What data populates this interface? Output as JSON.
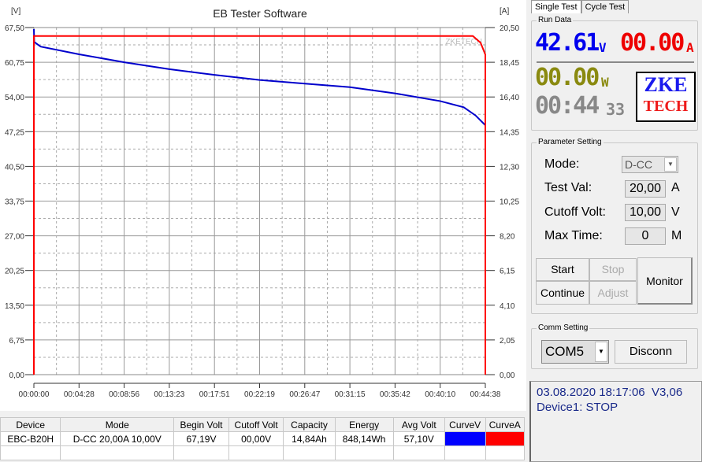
{
  "tabs": [
    "Single Test",
    "Cycle Test"
  ],
  "run_data": {
    "label": "Run Data",
    "voltage": "42.61",
    "voltage_unit": "V",
    "current": "00.00",
    "current_unit": "A",
    "power": "00.00",
    "power_unit": "W",
    "time": "00:44",
    "time_sec": "33",
    "logo_top": "ZKE",
    "logo_bottom": "TECH"
  },
  "parameter": {
    "label": "Parameter Setting",
    "mode_label": "Mode:",
    "mode_value": "D-CC",
    "test_val_label": "Test Val:",
    "test_val": "20,00",
    "test_val_unit": "A",
    "cutoff_label": "Cutoff Volt:",
    "cutoff_val": "10,00",
    "cutoff_unit": "V",
    "max_time_label": "Max Time:",
    "max_time": "0",
    "max_time_unit": "M",
    "buttons": {
      "start": "Start",
      "stop": "Stop",
      "continue": "Continue",
      "adjust": "Adjust",
      "monitor": "Monitor"
    }
  },
  "comm": {
    "label": "Comm Setting",
    "port": "COM5",
    "disconnect": "Disconn"
  },
  "status": {
    "line1": "03.08.2020 18:17:06  V3,06",
    "line2": "Device1: STOP"
  },
  "table": {
    "headers": [
      "Device",
      "Mode",
      "Begin Volt",
      "Cutoff Volt",
      "Capacity",
      "Energy",
      "Avg Volt",
      "CurveV",
      "CurveA"
    ],
    "rows": [
      [
        "EBC-B20H",
        "D-CC  20,00A  10,00V",
        "67,19V",
        "00,00V",
        "14,84Ah",
        "848,14Wh",
        "57,10V",
        "",
        ""
      ]
    ],
    "curve_colors": [
      "#0000ff",
      "#ff0000"
    ]
  },
  "chart_data": {
    "type": "line",
    "title": "EB Tester Software",
    "ylabel": "[V]",
    "y2label": "[A]",
    "watermark": "ZKETECH",
    "ylim": [
      0,
      67.5
    ],
    "y2lim": [
      0,
      20.5
    ],
    "xlim": [
      "00:00:00",
      "00:44:38"
    ],
    "grid": true,
    "yticks": [
      "0,00",
      "6,75",
      "13,50",
      "20,25",
      "27,00",
      "33,75",
      "40,50",
      "47,25",
      "54,00",
      "60,75",
      "67,50"
    ],
    "y2ticks": [
      "0,00",
      "2,05",
      "4,10",
      "6,15",
      "8,20",
      "10,25",
      "12,30",
      "14,35",
      "16,40",
      "18,45",
      "20,50"
    ],
    "xticks": [
      "00:00:00",
      "00:04:28",
      "00:08:56",
      "00:13:23",
      "00:17:51",
      "00:22:19",
      "00:26:47",
      "00:31:15",
      "00:35:42",
      "00:40:10",
      "00:44:38"
    ],
    "series": [
      {
        "axis": "left",
        "color": "#0000cc",
        "points": [
          [
            "00:00:00",
            67.2
          ],
          [
            "00:00:02",
            64.7
          ],
          [
            "00:00:40",
            63.8
          ],
          [
            "00:04:28",
            62.3
          ],
          [
            "00:08:56",
            60.75
          ],
          [
            "00:13:23",
            59.4
          ],
          [
            "00:17:51",
            58.3
          ],
          [
            "00:22:19",
            57.3
          ],
          [
            "00:26:47",
            56.6
          ],
          [
            "00:31:15",
            55.9
          ],
          [
            "00:35:42",
            54.7
          ],
          [
            "00:40:10",
            53.2
          ],
          [
            "00:42:30",
            52.0
          ],
          [
            "00:43:40",
            50.4
          ],
          [
            "00:44:38",
            48.5
          ]
        ]
      },
      {
        "axis": "right",
        "color": "#ff0000",
        "points": [
          [
            "00:00:00",
            0
          ],
          [
            "00:00:00",
            20.0
          ],
          [
            "00:43:24",
            20.0
          ],
          [
            "00:44:10",
            19.6
          ],
          [
            "00:44:38",
            18.9
          ],
          [
            "00:44:38",
            0
          ]
        ]
      }
    ]
  }
}
